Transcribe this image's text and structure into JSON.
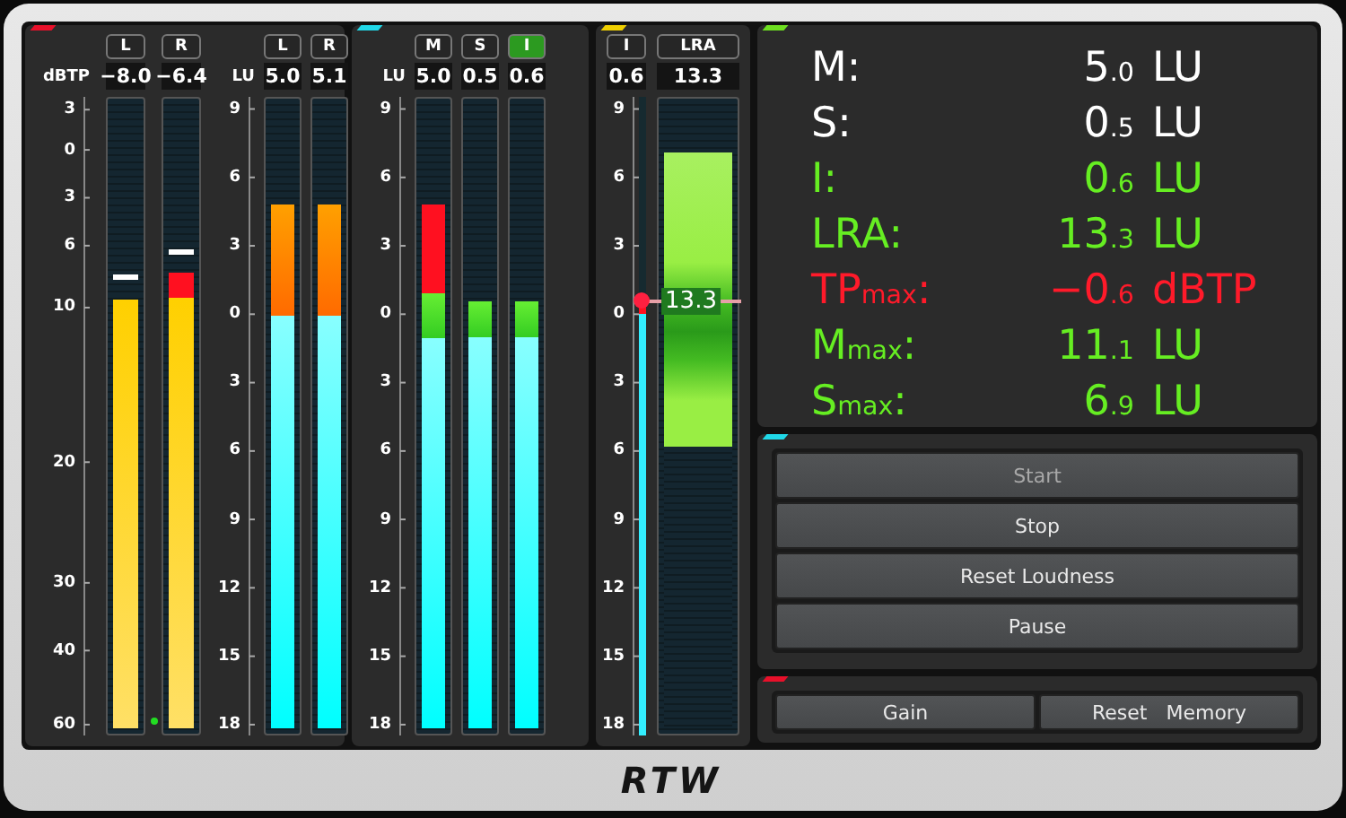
{
  "panels": [
    {
      "color": "#e8102a",
      "groups": [
        {
          "kind": "dbtp",
          "unit": "dBTP",
          "ticks": [
            "3",
            "0",
            "3",
            "6",
            "10",
            "20",
            "30",
            "40",
            "60"
          ],
          "led": {
            "on": true
          },
          "channels": [
            {
              "label": "L",
              "reading": "−8.0",
              "level": 0.686,
              "hold": {
                "level": 0.717
              }
            },
            {
              "label": "R",
              "reading": "−6.4",
              "level": 0.73,
              "hold": {
                "level": 0.758
              }
            }
          ]
        },
        {
          "kind": "lu_ch",
          "unit": "LU",
          "ticks": [
            "9",
            "6",
            "3",
            "0",
            "3",
            "6",
            "9",
            "12",
            "15",
            "18"
          ],
          "channels": [
            {
              "label": "L",
              "reading": "5.0",
              "level": 0.84
            },
            {
              "label": "R",
              "reading": "5.1",
              "level": 0.84
            }
          ]
        }
      ]
    },
    {
      "color": "#20d8e8",
      "groups": [
        {
          "kind": "lu_msi",
          "unit": "LU",
          "ticks": [
            "9",
            "6",
            "3",
            "0",
            "3",
            "6",
            "9",
            "12",
            "15",
            "18"
          ],
          "channels": [
            {
              "label": "M",
              "reading": "5.0",
              "level": 0.84,
              "selected": false
            },
            {
              "label": "S",
              "reading": "0.5",
              "level": 0.683,
              "selected": false
            },
            {
              "label": "I",
              "reading": "0.6",
              "level": 0.683,
              "selected": true
            }
          ]
        }
      ]
    },
    {
      "color": "#f0d000",
      "groups": [
        {
          "kind": "lra",
          "ticks": [
            "9",
            "6",
            "3",
            "0",
            "3",
            "6",
            "9",
            "12",
            "15",
            "18"
          ],
          "channels": [
            {
              "kind": "thin",
              "label": "I",
              "reading": "0.6",
              "level": 0.689
            },
            {
              "kind": "range",
              "label": "LRA",
              "reading": "13.3",
              "top": {
                "level": 0.922
              },
              "bottom": {
                "level": 0.45
              },
              "marker": "13.3"
            }
          ]
        }
      ]
    }
  ],
  "readout": {
    "color": "#6ee020",
    "rows": [
      {
        "label": "M:",
        "value": "5$_{.0}$",
        "unit": "LU",
        "color": "#ffffff"
      },
      {
        "label": "S:",
        "value": "0$_{.5}$",
        "unit": "LU",
        "color": "#ffffff"
      },
      {
        "label": "I:",
        "value": "0$_{.6}$",
        "unit": "LU",
        "color": "#66ee22"
      },
      {
        "label": "LRA:",
        "value": "13$_{.3}$",
        "unit": "LU",
        "color": "#66ee22"
      },
      {
        "label": "TP$_{max}$:",
        "value": "−0$_{.6}$",
        "unit": "dBTP",
        "color": "#ff1a2a"
      },
      {
        "label": "M$_{max}$:",
        "value": "11$_{.1}$",
        "unit": "LU",
        "color": "#66ee22"
      },
      {
        "label": "S$_{max}$:",
        "value": "6$_{.9}$",
        "unit": "LU",
        "color": "#66ee22"
      }
    ]
  },
  "controls": {
    "color": "#20d8e8",
    "buttons": [
      {
        "label": "Start",
        "disabled": true
      },
      {
        "label": "Stop",
        "disabled": false
      },
      {
        "label": "Reset Loudness",
        "disabled": false
      },
      {
        "label": "Pause",
        "disabled": false
      }
    ]
  },
  "memory": {
    "color": "#e8102a",
    "buttons": [
      "Gain",
      "Reset   Memory"
    ]
  },
  "footer": {
    "logo": "RTW"
  }
}
